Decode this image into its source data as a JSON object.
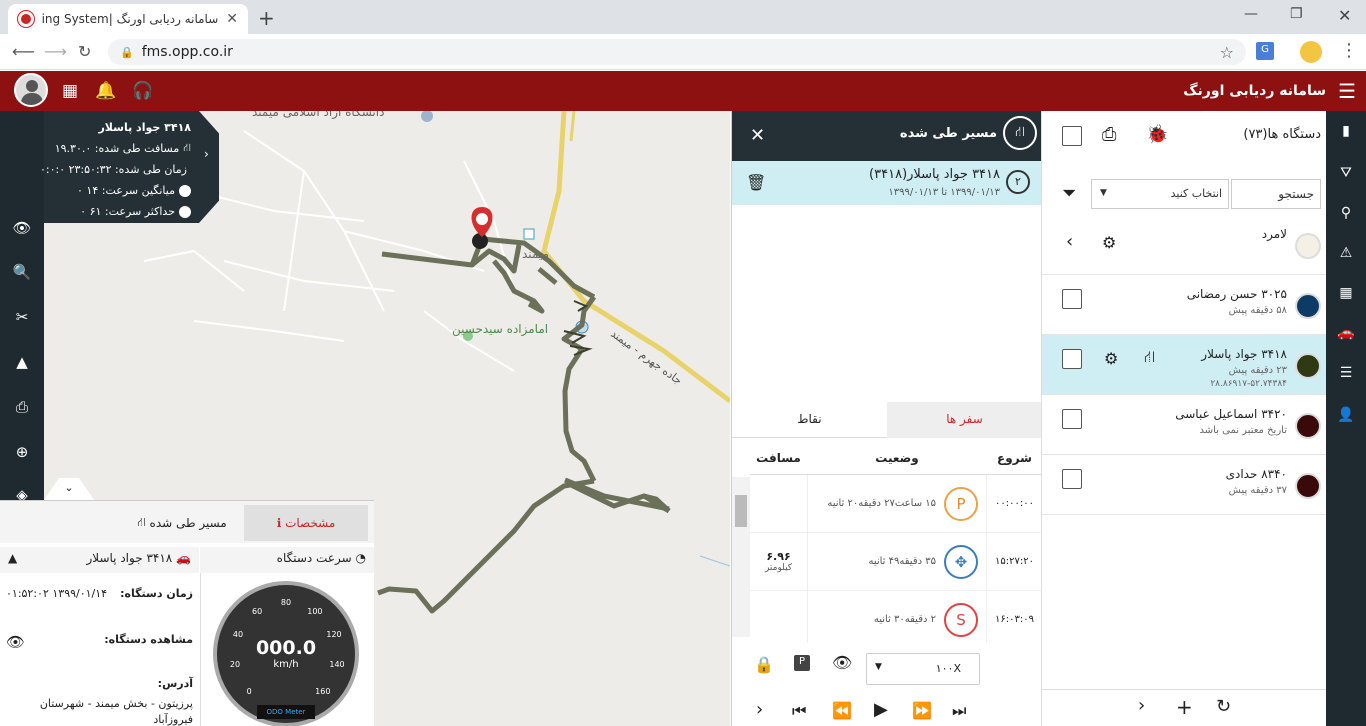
{
  "browser": {
    "tab_title": "سامانه ردیابی اورنگ |Tracking System",
    "tab_title_visible": "سامانه ردیابی اورنگ |king System",
    "url": "fms.opp.co.ir"
  },
  "app": {
    "brand": "سامانه ردیابی اورنگ"
  },
  "map": {
    "label_university": "دانشگاه آزاد اسلامی میمند",
    "label_town": "میمند",
    "label_shrine": "امامزاده سیدحسین",
    "label_road": "جاده جهرم - میمند"
  },
  "summary": {
    "vehicle": "۳۴۱۸ جواد پاسلار",
    "distance": "مسافت طی شده: ۱۹.۳۰.۰",
    "duration": "زمان طی شده: ۲۳:۵۰:۳۲ ۰:۰:۰",
    "avg_speed": "میانگین سرعت: ۱۴ ۰",
    "max_speed": "حداکثر سرعت: ۶۱ ۰"
  },
  "info_panel": {
    "tab_specs": "مشخصات",
    "tab_route": "مسیر طی شده",
    "speed_title": "سرعت دستگاه",
    "vehicle": "۳۴۱۸ جواد پاسلار",
    "device_time_label": "زمان دستگاه:",
    "device_time_value": "۱۳۹۹/۰۱/۱۴ ۰۱:۵۲:۰۲",
    "device_view_label": "مشاهده دستگاه:",
    "address_label": "آدرس:",
    "address_value": "پرزیتون - بخش میمند - شهرستان فیروزآباد",
    "gauge_value": "000.0",
    "gauge_unit": "km/h",
    "gauge_ticks": [
      "0",
      "20",
      "40",
      "60",
      "80",
      "100",
      "120",
      "140",
      "160"
    ],
    "odo_label": "ODO Meter"
  },
  "route_panel": {
    "title": "مسیر طی شده",
    "close": "✕",
    "selected": {
      "number": "۲",
      "name": "۳۴۱۸ جواد پاسلار(۳۴۱۸)",
      "dates": "۱۳۹۹/۰۱/۱۳ تا ۱۳۹۹/۰۱/۱۳"
    },
    "tab_trips": "سفر ها",
    "tab_points": "نقاط",
    "col_start": "شروع",
    "col_status": "وضعیت",
    "col_distance": "مسافت",
    "rows": [
      {
        "start": "۰۰:۰۰:۰۰",
        "badge": "P",
        "status": "۱۵ ساعت۲۷ دقیقه۲۰ ثانیه",
        "distance": "",
        "unit": ""
      },
      {
        "start": "۱۵:۲۷:۲۰",
        "badge": "✥",
        "status": "۳۵ دقیقه۴۹ ثانیه",
        "distance": "۶.۹۶",
        "unit": "کیلومتر"
      },
      {
        "start": "۱۶:۰۳:۰۹",
        "badge": "S",
        "status": "۲ دقیقه۳۰ ثانیه",
        "distance": "",
        "unit": ""
      }
    ],
    "speed_select": "۱۰۰X"
  },
  "device_panel": {
    "title": "دستگاه ها(۷۳)",
    "search_placeholder": "جستجو",
    "select_label": "انتخاب کنید",
    "group": "لامرد",
    "devices": [
      {
        "name": "۳۰۲۵ حسن رمضانی",
        "sub": "۵۸ دقیقه پیش",
        "coord": "",
        "color": "#0d3b66"
      },
      {
        "name": "۳۴۱۸ جواد پاسلار",
        "sub": "۲۳ دقیقه پیش",
        "coord": "۲۸.۸۶۹۱۷-۵۲.۷۴۳۸۴",
        "color": "#2f3a14"
      },
      {
        "name": "۳۴۲۰ اسماعیل عباسی",
        "sub": "تاریخ معتبر نمی باشد",
        "coord": "",
        "color": "#3a0a0a"
      },
      {
        "name": "۸۳۴۰ حدادی",
        "sub": "۳۷ دقیقه پیش",
        "coord": "",
        "color": "#3a0a0a"
      }
    ]
  },
  "colors": {
    "header": "#8e1111",
    "dark_panel": "#253036",
    "selected_row": "#cfeef3",
    "route_line": "#6b7058"
  }
}
